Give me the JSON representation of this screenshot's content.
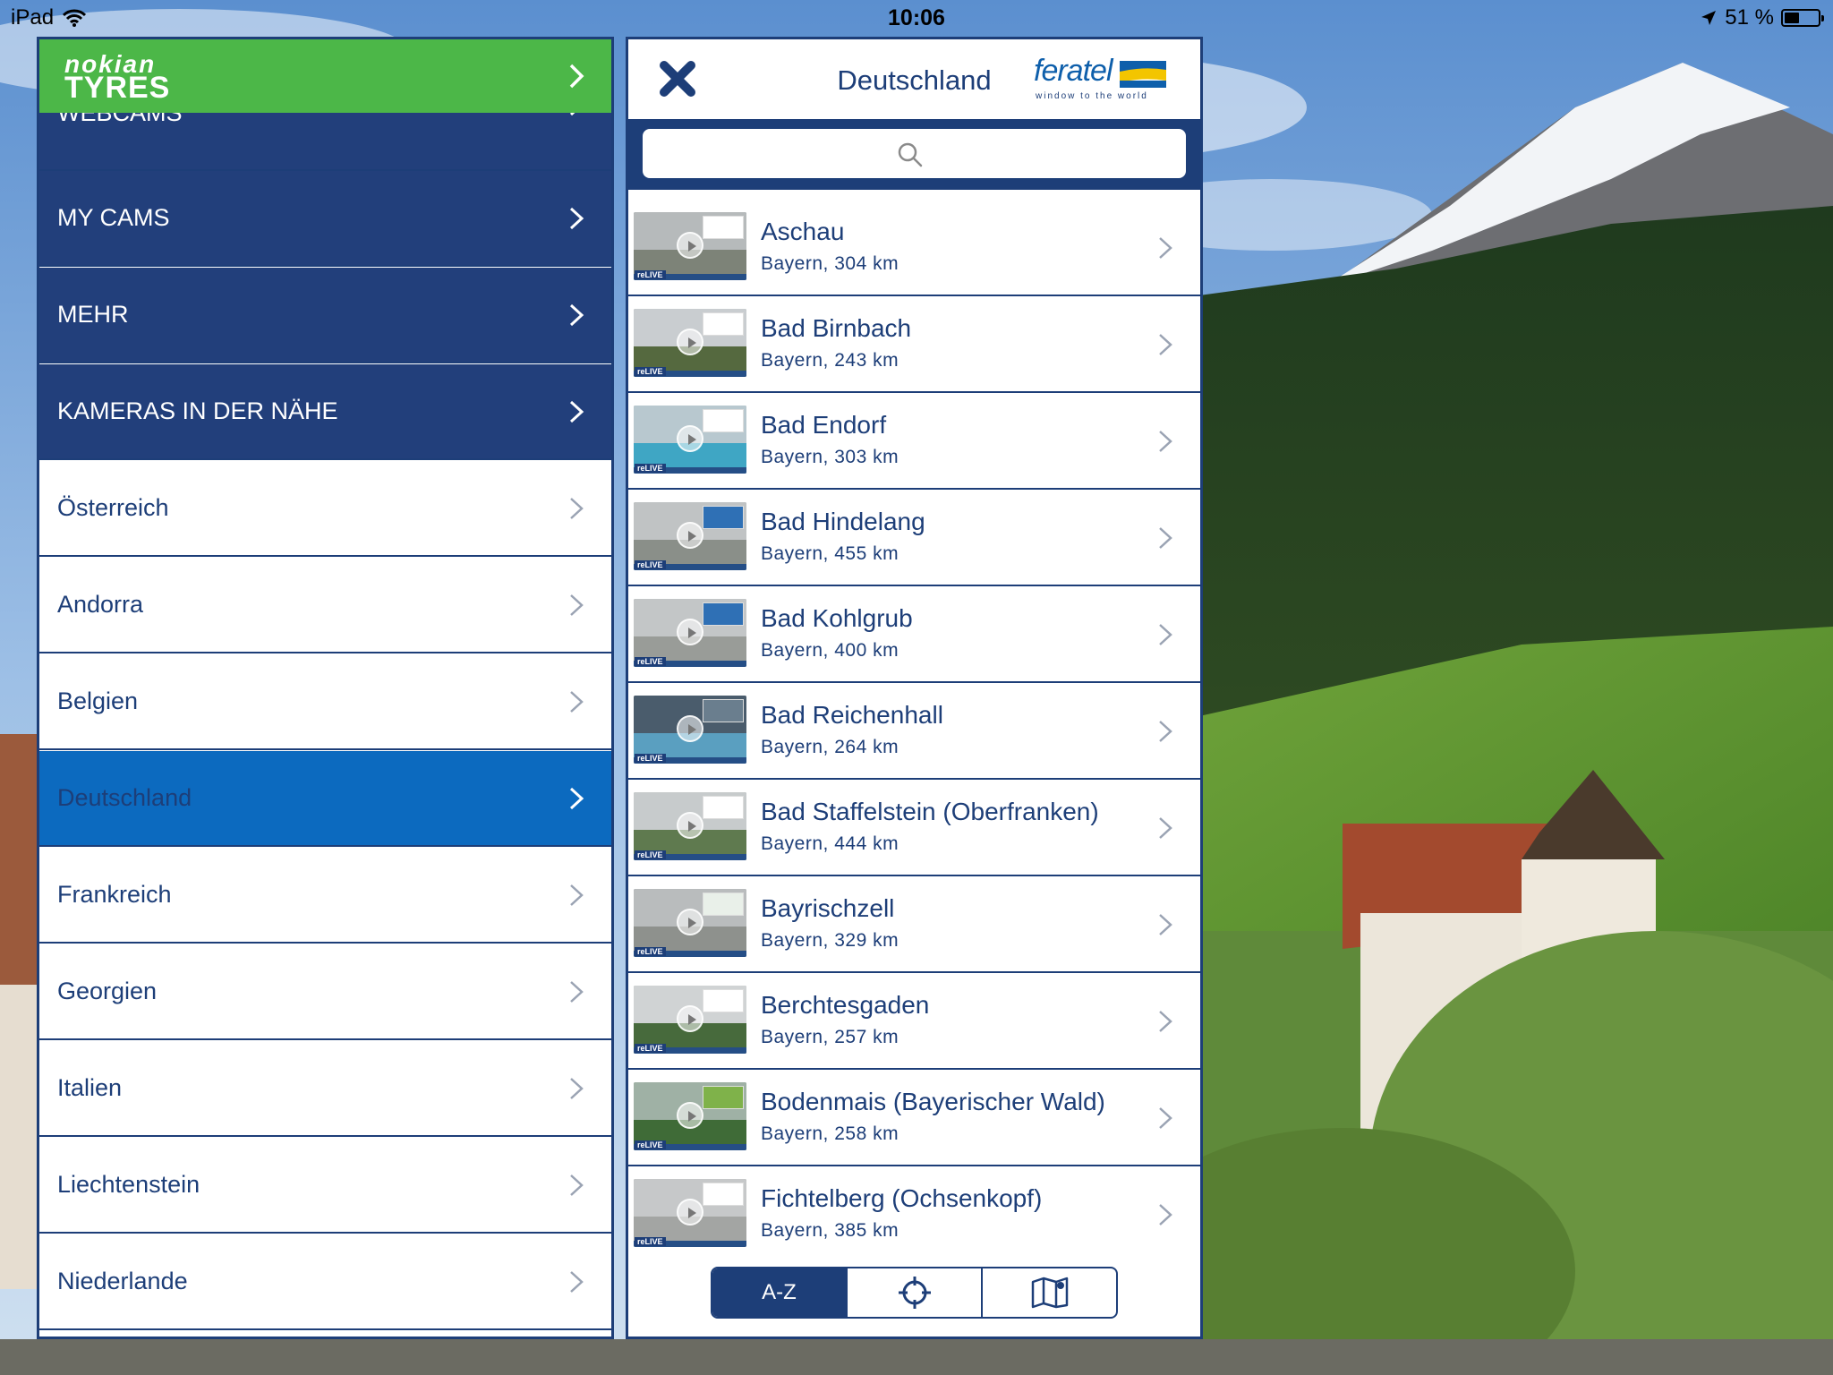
{
  "status_bar": {
    "device": "iPad",
    "time": "10:06",
    "battery": "51 %",
    "battery_level": 0.51
  },
  "sponsor": {
    "logo_line1": "nokian",
    "logo_line2": "TYRES",
    "color": "#4cb748"
  },
  "menu": {
    "items": [
      {
        "label": "WEBCAMS"
      },
      {
        "label": "MY CAMS"
      },
      {
        "label": "MEHR"
      },
      {
        "label": "KAMERAS IN DER NÄHE"
      },
      {
        "label": "Österreich"
      },
      {
        "label": "Andorra"
      },
      {
        "label": "Belgien"
      },
      {
        "label": "Deutschland",
        "selected": true
      },
      {
        "label": "Frankreich"
      },
      {
        "label": "Georgien"
      },
      {
        "label": "Italien"
      },
      {
        "label": "Liechtenstein"
      },
      {
        "label": "Niederlande"
      }
    ]
  },
  "list": {
    "title": "Deutschland",
    "brand": {
      "word": "feratel",
      "tagline": "window to the world"
    },
    "search": {
      "placeholder": ""
    },
    "live_label": "reLIVE",
    "cameras": [
      {
        "name": "Aschau",
        "subtitle": "Bayern, 304 km"
      },
      {
        "name": "Bad Birnbach",
        "subtitle": "Bayern, 243 km"
      },
      {
        "name": "Bad Endorf",
        "subtitle": "Bayern, 303 km"
      },
      {
        "name": "Bad Hindelang",
        "subtitle": "Bayern, 455 km"
      },
      {
        "name": "Bad Kohlgrub",
        "subtitle": "Bayern, 400 km"
      },
      {
        "name": "Bad Reichenhall",
        "subtitle": "Bayern, 264 km"
      },
      {
        "name": "Bad Staffelstein (Oberfranken)",
        "subtitle": "Bayern, 444 km"
      },
      {
        "name": "Bayrischzell",
        "subtitle": "Bayern, 329 km"
      },
      {
        "name": "Berchtesgaden",
        "subtitle": "Bayern, 257 km"
      },
      {
        "name": "Bodenmais (Bayerischer Wald)",
        "subtitle": "Bayern, 258 km"
      },
      {
        "name": "Fichtelberg (Ochsenkopf)",
        "subtitle": "Bayern, 385 km"
      }
    ],
    "sort_tabs": [
      {
        "label": "A-Z",
        "active": true
      },
      {
        "icon": "crosshair-icon"
      },
      {
        "icon": "map-icon"
      }
    ]
  },
  "colors": {
    "navy": "#1d3e78",
    "menu_dark": "#223f7b",
    "selected": "#0c6abf",
    "accent_green": "#4cb748"
  }
}
